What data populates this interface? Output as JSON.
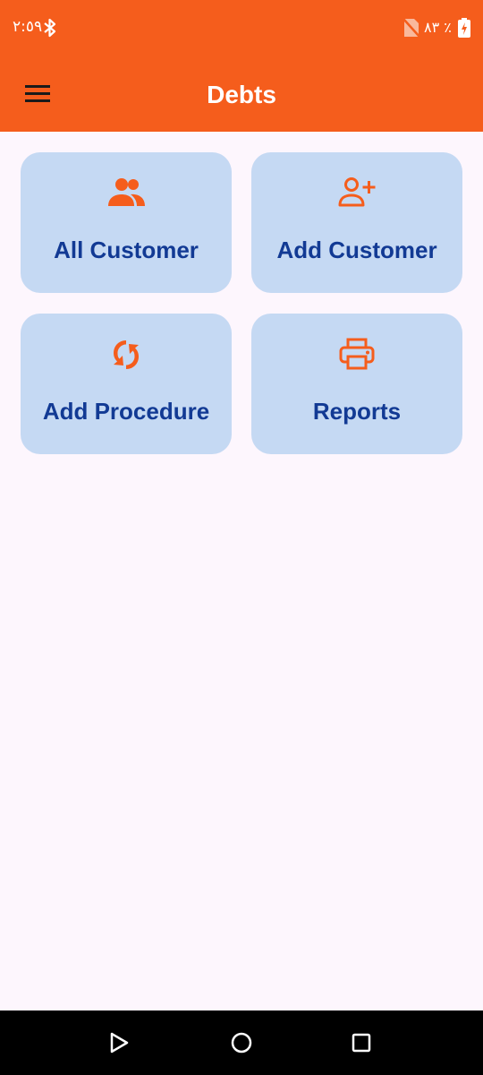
{
  "status_bar": {
    "time": "٢:٥٩",
    "battery_text": "٨٣ ٪",
    "icons": [
      "bluetooth-icon",
      "no-sim-icon",
      "battery-charging-icon"
    ]
  },
  "app_bar": {
    "title": "Debts",
    "menu_icon": "hamburger-menu-icon",
    "color": "#f55d1c"
  },
  "cards": [
    {
      "label": "All Customer",
      "icon": "people-icon"
    },
    {
      "label": "Add Customer",
      "icon": "person-add-icon"
    },
    {
      "label": "Add Procedure",
      "icon": "sync-icon"
    },
    {
      "label": "Reports",
      "icon": "printer-icon"
    }
  ],
  "colors": {
    "accent": "#f55d1c",
    "card_background": "#c5d9f3",
    "card_text": "#123a94",
    "page_background": "#fdf6fd"
  },
  "nav_bar": {
    "buttons": [
      "back-triangle-icon",
      "home-circle-icon",
      "recents-square-icon"
    ]
  }
}
